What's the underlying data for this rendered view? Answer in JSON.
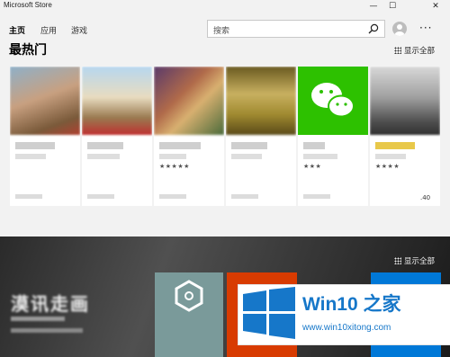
{
  "window": {
    "title": "Microsoft Store",
    "minimize": "—",
    "maximize": "☐",
    "close": "✕"
  },
  "nav": {
    "tabs": [
      {
        "label": "主页"
      },
      {
        "label": "应用"
      },
      {
        "label": "游戏"
      }
    ]
  },
  "search": {
    "placeholder": "搜索"
  },
  "more": "···",
  "section": {
    "title": "最热门",
    "show_all": "显示全部"
  },
  "cards": [
    {
      "rating": "",
      "price": ""
    },
    {
      "rating": "",
      "price": ""
    },
    {
      "rating": "★★★★★",
      "price": ""
    },
    {
      "rating": "",
      "price": ""
    },
    {
      "rating": "★★★",
      "price": ""
    },
    {
      "rating": "★★★★",
      "price": ".40"
    }
  ],
  "banner": {
    "title": "漠讯走画",
    "show_all": "显示全部"
  },
  "watermark": {
    "title": "Win10 之家",
    "url": "www.win10xitong.com"
  },
  "colors": {
    "accent": "#1677c9",
    "wechat_green": "#2dc100",
    "office_orange": "#d83b01",
    "win_blue": "#0078d7"
  }
}
